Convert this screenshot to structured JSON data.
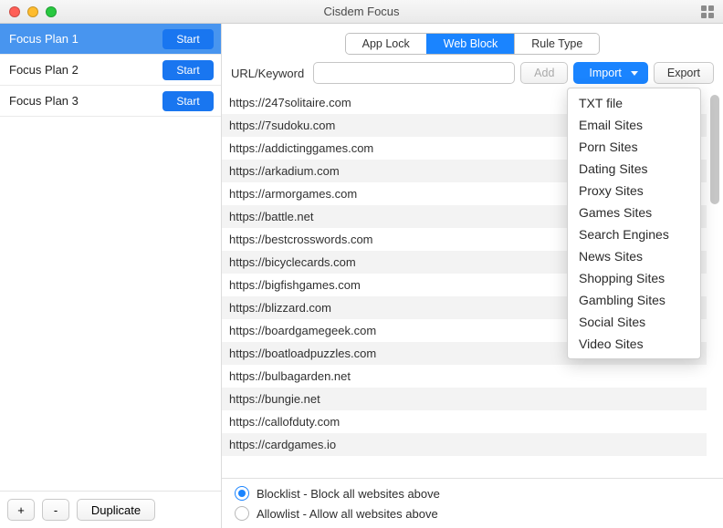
{
  "window": {
    "title": "Cisdem Focus"
  },
  "sidebar": {
    "plans": [
      {
        "label": "Focus Plan 1",
        "button": "Start",
        "selected": true
      },
      {
        "label": "Focus Plan 2",
        "button": "Start",
        "selected": false
      },
      {
        "label": "Focus Plan 3",
        "button": "Start",
        "selected": false
      }
    ],
    "footer": {
      "add": "+",
      "remove": "-",
      "duplicate": "Duplicate"
    }
  },
  "tabs": {
    "items": [
      "App Lock",
      "Web Block",
      "Rule Type"
    ],
    "active_index": 1
  },
  "toolbar": {
    "label": "URL/Keyword",
    "input_value": "",
    "add": "Add",
    "import": "Import",
    "export": "Export"
  },
  "import_menu": {
    "items": [
      "TXT file",
      "Email Sites",
      "Porn Sites",
      "Dating Sites",
      "Proxy Sites",
      "Games Sites",
      "Search Engines",
      "News Sites",
      "Shopping Sites",
      "Gambling Sites",
      "Social Sites",
      "Video Sites"
    ]
  },
  "urls": [
    "https://247solitaire.com",
    "https://7sudoku.com",
    "https://addictinggames.com",
    "https://arkadium.com",
    "https://armorgames.com",
    "https://battle.net",
    "https://bestcrosswords.com",
    "https://bicyclecards.com",
    "https://bigfishgames.com",
    "https://blizzard.com",
    "https://boardgamegeek.com",
    "https://boatloadpuzzles.com",
    "https://bulbagarden.net",
    "https://bungie.net",
    "https://callofduty.com",
    "https://cardgames.io"
  ],
  "list_mode": {
    "blocklist": "Blocklist - Block all websites above",
    "allowlist": "Allowlist - Allow all websites above",
    "selected": "blocklist"
  }
}
